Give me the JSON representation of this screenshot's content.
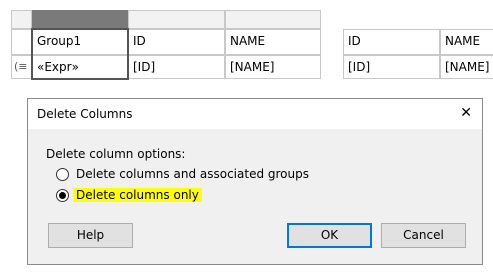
{
  "designer": {
    "left_table": {
      "group_header": "Group1",
      "columns": [
        "ID",
        "NAME"
      ],
      "group_expr": "«Expr»",
      "row": [
        "[ID]",
        "[NAME]"
      ]
    },
    "right_table": {
      "columns": [
        "ID",
        "NAME"
      ],
      "row": [
        "[ID]",
        "[NAME]"
      ]
    }
  },
  "dialog": {
    "title": "Delete Columns",
    "close_glyph": "✕",
    "section_label": "Delete column options:",
    "options": [
      {
        "label": "Delete columns and associated groups",
        "selected": false
      },
      {
        "label": "Delete columns only",
        "selected": true,
        "highlight": "#ffff00"
      }
    ],
    "buttons": {
      "help": "Help",
      "ok": "OK",
      "cancel": "Cancel"
    }
  }
}
